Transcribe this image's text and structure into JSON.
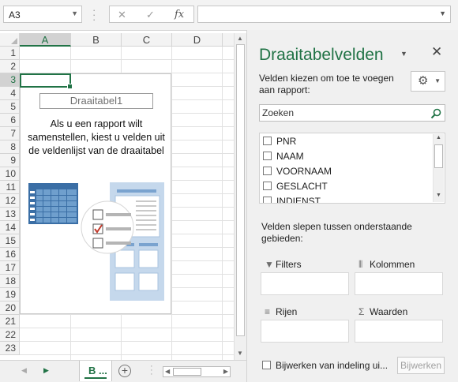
{
  "namebox": {
    "value": "A3"
  },
  "formula_bar": {
    "cancel_icon": "✕",
    "enter_icon": "✓",
    "fx_label": "fx"
  },
  "sheet": {
    "columns": [
      "A",
      "B",
      "C",
      "D"
    ],
    "selected_column": "A",
    "rows": [
      "1",
      "2",
      "3",
      "4",
      "5",
      "6",
      "7",
      "8",
      "9",
      "10",
      "11",
      "12",
      "13",
      "14",
      "15",
      "16",
      "17",
      "18",
      "19",
      "20",
      "21",
      "22",
      "23"
    ],
    "selected_row": "3",
    "active_cell": "A3"
  },
  "pivot_placeholder": {
    "name": "Draaitabel1",
    "message": "Als u een rapport wilt samenstellen, kiest u velden uit de veldenlijst van de draaitabel"
  },
  "tabs": {
    "sheet_name": "B ...",
    "add_sheet": "+"
  },
  "pane": {
    "title": "Draaitabelvelden",
    "subtitle": "Velden kiezen om toe te voegen aan rapport:",
    "search_placeholder": "Zoeken",
    "fields": [
      "PNR",
      "NAAM",
      "VOORNAAM",
      "GESLACHT",
      "INDIENST"
    ],
    "drag_label": "Velden slepen tussen onderstaande gebieden:",
    "areas": {
      "filters": "Filters",
      "columns": "Kolommen",
      "rows": "Rijen",
      "values": "Waarden"
    },
    "defer_label": "Bijwerken van indeling ui...",
    "update_button": "Bijwerken"
  },
  "colors": {
    "accent": "#217346",
    "pane_bg": "#f0f0f0",
    "chrome_bg": "#f3f3f3"
  }
}
